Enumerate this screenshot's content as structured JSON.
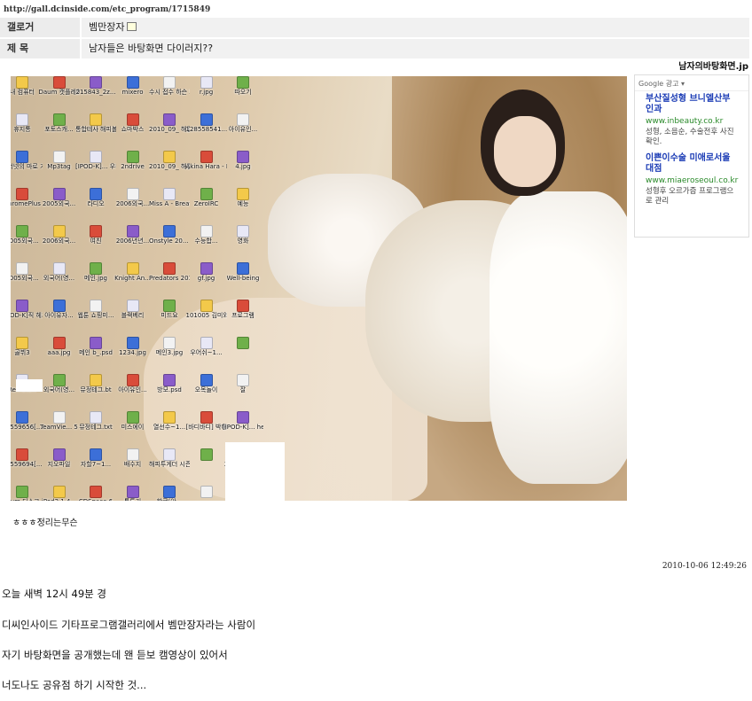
{
  "page": {
    "url": "http://gall.dcinside.com/etc_program/1715849",
    "top_right_text": "남자의바탕화면.jp"
  },
  "meta": {
    "author_label": "갤로거",
    "author_value": "벰만장자",
    "title_label": "제 목",
    "title_value": "남자들은 바탕화면 다이러지??"
  },
  "desktop_icons": [
    "내 컴퓨터",
    "Daum 캣플레이...",
    "215843_2z...",
    "mixero",
    "수시 접수 하슨 모험...",
    "r.jpg",
    "따오기",
    "휴지통",
    "포토스캐...",
    "통합테사 해피볼로...",
    "쇼마박스",
    "2010_09_ 해결.hwp",
    "128558541...",
    "아이유인...",
    "인터넷의 마로 가기",
    "Mp3tag",
    "[IPOD-K]... 우비 Killer...",
    "2ndrive",
    "2010_09_ 해결.hwp",
    "Akina Hara - Fuck to S...",
    "4.jpg",
    "ChromePlus",
    "2005외국...",
    "라디오",
    "2006외국...",
    "Miss A - Breathe [...",
    "ZeroIRC",
    "예능",
    "2005외국...",
    "2006외국...",
    "여친",
    "2006년년...",
    "Onstyle 20... 수금모델",
    "수능합...",
    "영화",
    "2005외국...",
    "외국어(영...",
    "메인.jpg",
    "Knight An...",
    "Predators 2010 R5 ...",
    "gf.jpg",
    "Well-being",
    "[IPOD-K]직 헤즈 싸브...",
    "아이유자...",
    "웹툰 쇼핑미...",
    "블랙베리",
    "미드요",
    "101005 김미와익...",
    "프로그램",
    "골뷔3",
    "aaa.jpg",
    "메인 b_.psd",
    "1234.jpg",
    "메인3.jpg",
    "우어쉬~1...",
    "",
    "RemoteX",
    "외국어(영...",
    "뮤정테그.bt",
    "아이유인...",
    "방모.psd",
    "오목놀이",
    "잘",
    "28559656[...",
    "TeamVie... 5",
    "뮤정테그.txt",
    "미스에이",
    "열선수~1...",
    "[바디바디] 박해준 2.avi",
    "[IPOD-K]... he Runa...",
    "28559694[...",
    "지오파일",
    "자할7~1...",
    "배수지",
    "해피투게더 시즌3E16...",
    "",
    "28006425...",
    "Daum 디스크...",
    "iPod2 1.4...",
    "CDSpace 6",
    "통투기",
    "한글(야...",
    ""
  ],
  "ad": {
    "label": "Google 광고 ▾",
    "items": [
      {
        "title": "부산질성형 브니엘산부인과",
        "url": "www.inbeauty.co.kr",
        "desc": "성형, 소음순, 수술전후 사진 확인."
      },
      {
        "title": "이쁜이수술 미애로서울대점",
        "url": "www.miaeroseoul.co.kr",
        "desc": "성형후 오르가즘 프로그램으로 관리"
      }
    ]
  },
  "caption": "ㅎㅎㅎ정리는무슨",
  "date": "2010-10-06 12:49:26",
  "body_lines": [
    "오늘 새벽 12시 49분 경",
    "디씨인사이드 기타프로그램갤러리에서 벰만장자라는 사람이",
    "자기 바탕화면을 공개했는데 왠 듣보 캠영상이 있어서",
    "너도나도 공유점 하기 시작한 것..."
  ],
  "colors": {
    "link_title": "#1a3bb5",
    "link_url": "#2a8a2a",
    "meta_bg": "#f1f1f1"
  }
}
